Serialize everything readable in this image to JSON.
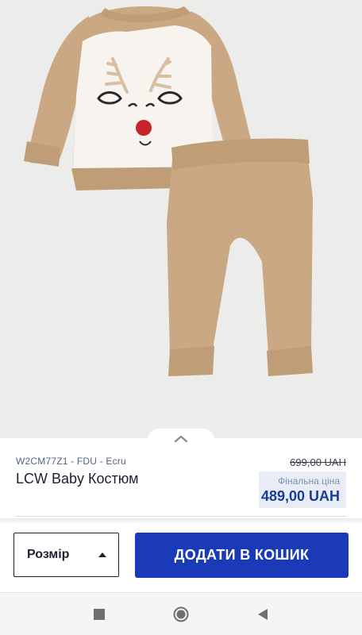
{
  "product": {
    "sku": "W2CM77Z1 - FDU - Ecru",
    "title": "LCW Baby Костюм",
    "old_price": "699,00 UAH",
    "final_price_label": "Фінальна ціна",
    "final_price": "489,00 UAH",
    "image_alt_icon": "product-photo"
  },
  "actions": {
    "size_label": "Розмір",
    "size_icon": "caret-up-icon",
    "add_to_cart_label": "ДОДАТИ В КОШИК"
  },
  "navigation": {
    "icons": [
      "recent-apps-icon",
      "home-icon",
      "back-icon"
    ]
  },
  "colors": {
    "accent": "#1a3ab8",
    "final_price": "#1a3a9a",
    "final_price_bg": "#e8edf5",
    "image_bg": "#ececeb",
    "garment": "#c9a883"
  }
}
